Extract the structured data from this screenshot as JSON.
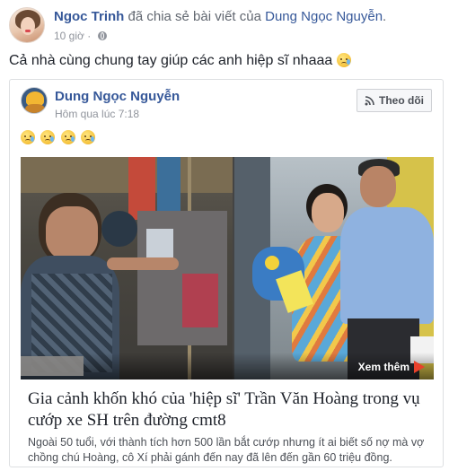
{
  "post": {
    "author": "Ngoc Trinh",
    "action": "đã chia sẻ bài viết của",
    "shared_from": "Dung Ngọc Nguyễn",
    "period": ".",
    "time": "10 giờ",
    "separator": "·",
    "privacy_icon": "globe-icon",
    "status_text": "Cả nhà cùng chung tay giúp các anh hiệp sĩ nhaaa"
  },
  "shared": {
    "author": "Dung Ngọc Nguyễn",
    "time": "Hôm qua lúc 7:18",
    "follow_label": "Theo dõi",
    "follow_icon": "rss-icon",
    "emoji_count": 4,
    "emoji_name": "sad-tear-emoji"
  },
  "article": {
    "more_label": "Xem thêm",
    "title": "Gia cảnh khốn khó của 'hiệp sĩ' Trần Văn Hoàng trong vụ cướp xe SH trên đường cmt8",
    "description": "Ngoài 50 tuổi, với thành tích hơn 500 lần bắt cướp nhưng ít ai biết số nợ mà vợ chồng chú Hoàng, cô Xí phải gánh đến nay đã lên đến gần 60 triệu đồng."
  },
  "colors": {
    "link_blue": "#365899",
    "meta_gray": "#90949c",
    "text": "#1d2129",
    "border": "#dddfe2",
    "play_red": "#e9412b"
  }
}
